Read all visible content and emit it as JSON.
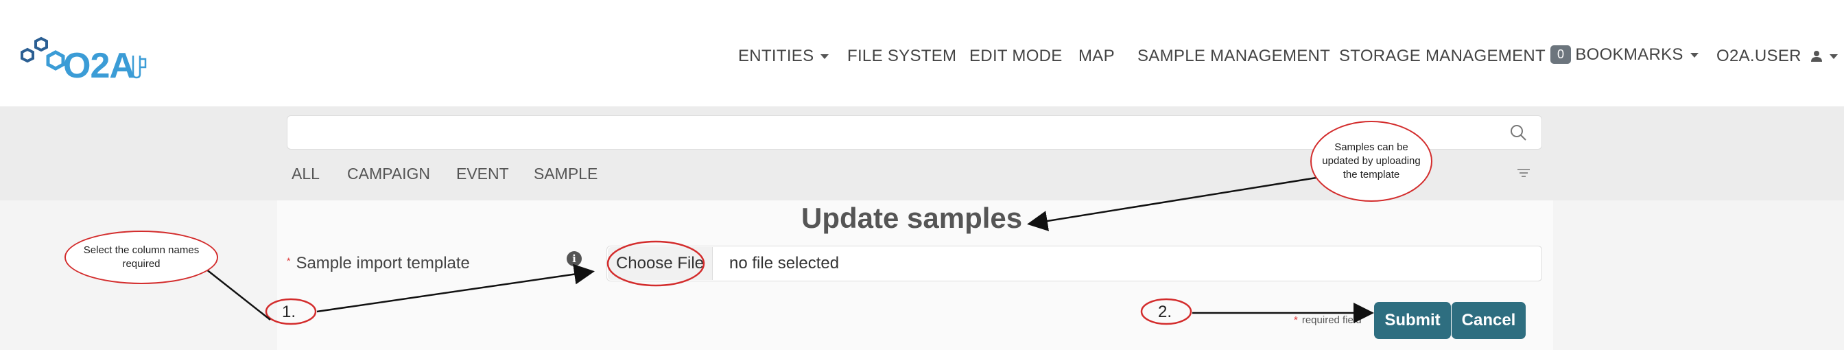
{
  "brand": {
    "logo_text": "O2A",
    "accent": "#3b9cd6"
  },
  "nav": {
    "entities": "ENTITIES",
    "file_system": "FILE SYSTEM",
    "edit_mode": "EDIT MODE",
    "map": "MAP",
    "sample_management": "SAMPLE MANAGEMENT",
    "storage_management": "STORAGE MANAGEMENT",
    "bookmarks_count": "0",
    "bookmarks": "BOOKMARKS",
    "user": "O2A.USER"
  },
  "search": {
    "placeholder": "",
    "icon": "search-icon",
    "tabs": [
      "ALL",
      "CAMPAIGN",
      "EVENT",
      "SAMPLE"
    ],
    "filter_icon": "filter-icon"
  },
  "form": {
    "title": "Update samples",
    "field_label": "Sample import template",
    "choose_file": "Choose File",
    "file_status": "no file selected",
    "required_note": "required field",
    "submit": "Submit",
    "cancel": "Cancel",
    "button_color": "#2e6e80"
  },
  "annotations": {
    "bubble_upload": "Samples can be updated by uploading the template",
    "bubble_columns": "Select the column names required",
    "step1": "1.",
    "step2": "2.",
    "highlight_color": "#d32c2c"
  }
}
